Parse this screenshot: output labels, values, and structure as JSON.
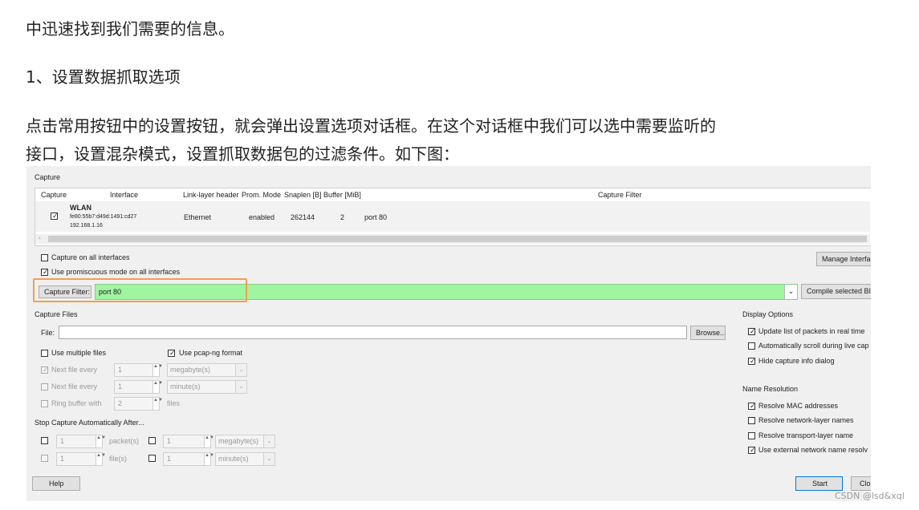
{
  "article": {
    "line1": "中迅速找到我们需要的信息。",
    "heading": "1、设置数据抓取选项",
    "line3": "点击常用按钮中的设置按钮，就会弹出设置选项对话框。在这个对话框中我们可以选中需要监听的",
    "line4": "接口，设置混杂模式，设置抓取数据包的过滤条件。如下图："
  },
  "dialog": {
    "capture_group": "Capture",
    "columns": [
      "Capture",
      "Interface",
      "Link-layer header",
      "Prom. Mode",
      "Snaplen [B]",
      "Buffer [MiB]",
      "Capture Filter"
    ],
    "iface": {
      "name": "WLAN",
      "ipv6": "fe80:55b7:d49d:1491:cd27",
      "ipv4": "192.168.1.16",
      "link": "Ethernet",
      "prom": "enabled",
      "snaplen": "262144",
      "buffer": "2",
      "filter": "port 80",
      "checked": true
    },
    "capture_all": "Capture on all interfaces",
    "promisc": "Use promiscuous mode on all interfaces",
    "manage_btn": "Manage Interfa",
    "filter_btn": "Capture Filter:",
    "filter_value": "port 80",
    "compile_btn": "Compile selected BI",
    "files_group": "Capture Files",
    "file_label": "File:",
    "file_value": "",
    "browse_btn": "Browse...",
    "multiple_files": "Use multiple files",
    "pcapng": "Use pcap-ng format",
    "next_file_1": "Next file every",
    "next_file_1_val": "1",
    "next_file_1_unit": "megabyte(s)",
    "next_file_2": "Next file every",
    "next_file_2_val": "1",
    "next_file_2_unit": "minute(s)",
    "ring_buffer": "Ring buffer with",
    "ring_buffer_val": "2",
    "ring_buffer_unit": "files",
    "stop_group": "Stop Capture Automatically After...",
    "stop1_val": "1",
    "stop1_unit": "packet(s)",
    "stop2_val": "1",
    "stop2_unit": "megabyte(s)",
    "stop3_val": "1",
    "stop3_unit": "file(s)",
    "stop4_val": "1",
    "stop4_unit": "minute(s)",
    "display_group": "Display Options",
    "disp1": "Update list of packets in real time",
    "disp2": "Automatically scroll during live cap",
    "disp3": "Hide capture info dialog",
    "name_group": "Name Resolution",
    "nr1": "Resolve MAC addresses",
    "nr2": "Resolve network-layer names",
    "nr3": "Resolve transport-layer name",
    "nr4": "Use external network name resolv",
    "help_btn": "Help",
    "start_btn": "Start",
    "close_btn": "Clo",
    "check_glyph": "✓",
    "spin_glyph": "▲▼",
    "scroll_left": "‹",
    "scroll_right": "›",
    "combo_arrow": "⌄"
  },
  "watermark": "CSDN @lsd&xql",
  "colors": {
    "filter_green": "#a0f5a0",
    "highlight": "#f0a050"
  }
}
